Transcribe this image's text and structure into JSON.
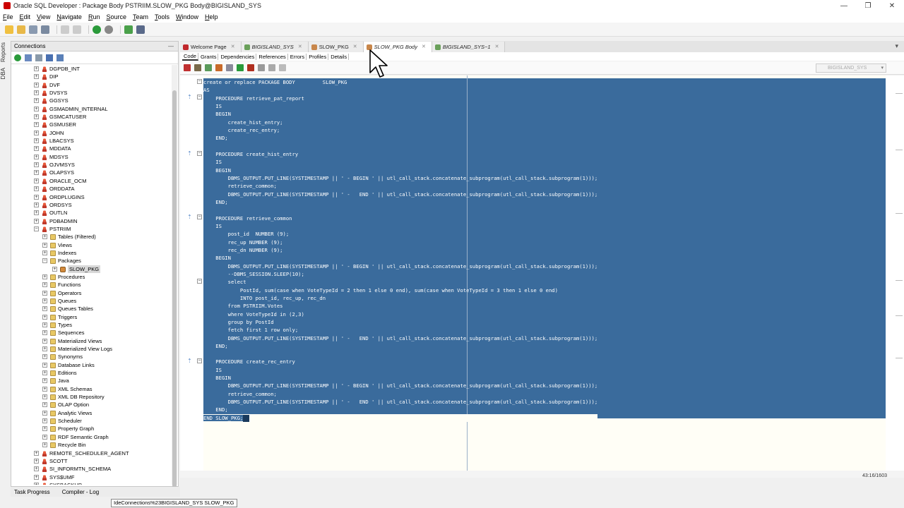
{
  "window": {
    "title": "Oracle SQL Developer : Package Body PSTRIIM.SLOW_PKG Body@BIGISLAND_SYS",
    "controls": [
      "—",
      "❐",
      "✕"
    ]
  },
  "menu": [
    "File",
    "Edit",
    "View",
    "Navigate",
    "Run",
    "Source",
    "Team",
    "Tools",
    "Window",
    "Help"
  ],
  "side_strip": [
    "Reports",
    "DBA"
  ],
  "connections": {
    "title": "Connections",
    "minimize": "—",
    "tree": [
      {
        "label": "DGPDB_INT",
        "icon": "user-icon",
        "level": 1
      },
      {
        "label": "DIP",
        "icon": "user-icon",
        "level": 1
      },
      {
        "label": "DVF",
        "icon": "user-icon",
        "level": 1
      },
      {
        "label": "DVSYS",
        "icon": "user-icon",
        "level": 1
      },
      {
        "label": "GGSYS",
        "icon": "user-icon",
        "level": 1
      },
      {
        "label": "GSMADMIN_INTERNAL",
        "icon": "user-icon",
        "level": 1
      },
      {
        "label": "GSMCATUSER",
        "icon": "user-icon",
        "level": 1
      },
      {
        "label": "GSMUSER",
        "icon": "user-icon",
        "level": 1
      },
      {
        "label": "JOHN",
        "icon": "user-icon",
        "level": 1
      },
      {
        "label": "LBACSYS",
        "icon": "user-icon",
        "level": 1
      },
      {
        "label": "MDDATA",
        "icon": "user-icon",
        "level": 1
      },
      {
        "label": "MDSYS",
        "icon": "user-icon",
        "level": 1
      },
      {
        "label": "OJVMSYS",
        "icon": "user-icon",
        "level": 1
      },
      {
        "label": "OLAPSYS",
        "icon": "user-icon",
        "level": 1
      },
      {
        "label": "ORACLE_OCM",
        "icon": "user-icon",
        "level": 1
      },
      {
        "label": "ORDDATA",
        "icon": "user-icon",
        "level": 1
      },
      {
        "label": "ORDPLUGINS",
        "icon": "user-icon",
        "level": 1
      },
      {
        "label": "ORDSYS",
        "icon": "user-icon",
        "level": 1
      },
      {
        "label": "OUTLN",
        "icon": "user-icon",
        "level": 1
      },
      {
        "label": "PDBADMIN",
        "icon": "user-icon",
        "level": 1
      },
      {
        "label": "PSTRIIM",
        "icon": "user-icon",
        "level": 1,
        "expanded": true
      },
      {
        "label": "Tables (Filtered)",
        "icon": "folder-icon",
        "level": 2
      },
      {
        "label": "Views",
        "icon": "folder-icon",
        "level": 2
      },
      {
        "label": "Indexes",
        "icon": "folder-icon",
        "level": 2
      },
      {
        "label": "Packages",
        "icon": "folder-icon",
        "level": 2,
        "expanded": true
      },
      {
        "label": "SLOW_PKG",
        "icon": "package-icon",
        "level": 3,
        "selected": true
      },
      {
        "label": "Procedures",
        "icon": "folder-icon",
        "level": 2
      },
      {
        "label": "Functions",
        "icon": "folder-icon",
        "level": 2
      },
      {
        "label": "Operators",
        "icon": "folder-icon",
        "level": 2
      },
      {
        "label": "Queues",
        "icon": "folder-icon",
        "level": 2
      },
      {
        "label": "Queues Tables",
        "icon": "folder-icon",
        "level": 2
      },
      {
        "label": "Triggers",
        "icon": "folder-icon",
        "level": 2
      },
      {
        "label": "Types",
        "icon": "folder-icon",
        "level": 2
      },
      {
        "label": "Sequences",
        "icon": "folder-icon",
        "level": 2
      },
      {
        "label": "Materialized Views",
        "icon": "folder-icon",
        "level": 2
      },
      {
        "label": "Materialized View Logs",
        "icon": "folder-icon",
        "level": 2
      },
      {
        "label": "Synonyms",
        "icon": "folder-icon",
        "level": 2
      },
      {
        "label": "Database Links",
        "icon": "folder-icon",
        "level": 2
      },
      {
        "label": "Editions",
        "icon": "folder-icon",
        "level": 2
      },
      {
        "label": "Java",
        "icon": "folder-icon",
        "level": 2
      },
      {
        "label": "XML Schemas",
        "icon": "folder-icon",
        "level": 2
      },
      {
        "label": "XML DB Repository",
        "icon": "folder-icon",
        "level": 2
      },
      {
        "label": "OLAP Option",
        "icon": "folder-icon",
        "level": 2
      },
      {
        "label": "Analytic Views",
        "icon": "folder-icon",
        "level": 2
      },
      {
        "label": "Scheduler",
        "icon": "folder-icon",
        "level": 2
      },
      {
        "label": "Property Graph",
        "icon": "folder-icon",
        "level": 2
      },
      {
        "label": "RDF Semantic Graph",
        "icon": "folder-icon",
        "level": 2
      },
      {
        "label": "Recycle Bin",
        "icon": "folder-icon",
        "level": 2
      },
      {
        "label": "REMOTE_SCHEDULER_AGENT",
        "icon": "user-icon",
        "level": 1
      },
      {
        "label": "SCOTT",
        "icon": "user-icon",
        "level": 1
      },
      {
        "label": "SI_INFORMTN_SCHEMA",
        "icon": "user-icon",
        "level": 1
      },
      {
        "label": "SYS$UMF",
        "icon": "user-icon",
        "level": 1
      },
      {
        "label": "SYSBACKUP",
        "icon": "user-icon",
        "level": 1
      }
    ]
  },
  "bottom_tabs": [
    "Task Progress",
    "Compiler - Log"
  ],
  "tooltip": "IdeConnections%23BIGISLAND_SYS SLOW_PKG",
  "editor": {
    "tabs": [
      {
        "label": "Welcome Page",
        "icon": "oracle-icon",
        "italic": false,
        "active": false
      },
      {
        "label": "BIGISLAND_SYS",
        "icon": "sql-worksheet-icon",
        "italic": true,
        "active": false
      },
      {
        "label": "SLOW_PKG",
        "icon": "package-icon",
        "italic": false,
        "active": false
      },
      {
        "label": "SLOW_PKG Body",
        "icon": "package-body-icon",
        "italic": true,
        "active": true
      },
      {
        "label": "BIGISLAND_SYS~1",
        "icon": "sql-worksheet-icon",
        "italic": true,
        "active": false
      }
    ],
    "tabs_menu": "▾",
    "subtabs": [
      "Code",
      "Grants",
      "Dependencies",
      "References",
      "Errors",
      "Profiles",
      "Details"
    ],
    "connection_select": "BIGISLAND_SYS",
    "code_lines": [
      "create or replace PACKAGE BODY         SLOW_PKG",
      "AS",
      "    PROCEDURE retrieve_pat_report",
      "    IS",
      "    BEGIN",
      "        create_hist_entry;",
      "        create_rec_entry;",
      "    END;",
      "",
      "    PROCEDURE create_hist_entry",
      "    IS",
      "    BEGIN",
      "        DBMS_OUTPUT.PUT_LINE(SYSTIMESTAMP || ' - BEGIN ' || utl_call_stack.concatenate_subprogram(utl_call_stack.subprogram(1)));",
      "        retrieve_common;",
      "        DBMS_OUTPUT.PUT_LINE(SYSTIMESTAMP || ' -   END ' || utl_call_stack.concatenate_subprogram(utl_call_stack.subprogram(1)));",
      "    END;",
      "",
      "    PROCEDURE retrieve_common",
      "    IS",
      "        post_id  NUMBER (9);",
      "        rec_up NUMBER (9);",
      "        rec_dn NUMBER (9);",
      "    BEGIN",
      "        DBMS_OUTPUT.PUT_LINE(SYSTIMESTAMP || ' - BEGIN ' || utl_call_stack.concatenate_subprogram(utl_call_stack.subprogram(1)));",
      "        --DBMS_SESSION.SLEEP(10);",
      "        select",
      "            PostId, sum(case when VoteTypeId = 2 then 1 else 0 end), sum(case when VoteTypeId = 3 then 1 else 0 end)",
      "            INTO post_id, rec_up, rec_dn",
      "        from PSTRIIM.Votes",
      "        where VoteTypeId in (2,3)",
      "        group by PostId",
      "        fetch first 1 row only;",
      "        DBMS_OUTPUT.PUT_LINE(SYSTIMESTAMP || ' -   END ' || utl_call_stack.concatenate_subprogram(utl_call_stack.subprogram(1)));",
      "    END;",
      "",
      "    PROCEDURE create_rec_entry",
      "    IS",
      "    BEGIN",
      "        DBMS_OUTPUT.PUT_LINE(SYSTIMESTAMP || ' - BEGIN ' || utl_call_stack.concatenate_subprogram(utl_call_stack.subprogram(1)));",
      "        retrieve_common;",
      "        DBMS_OUTPUT.PUT_LINE(SYSTIMESTAMP || ' -   END ' || utl_call_stack.concatenate_subprogram(utl_call_stack.subprogram(1)));",
      "    END;",
      "END SLOW_PKG;"
    ],
    "cursor_position": "43:16/1603"
  }
}
